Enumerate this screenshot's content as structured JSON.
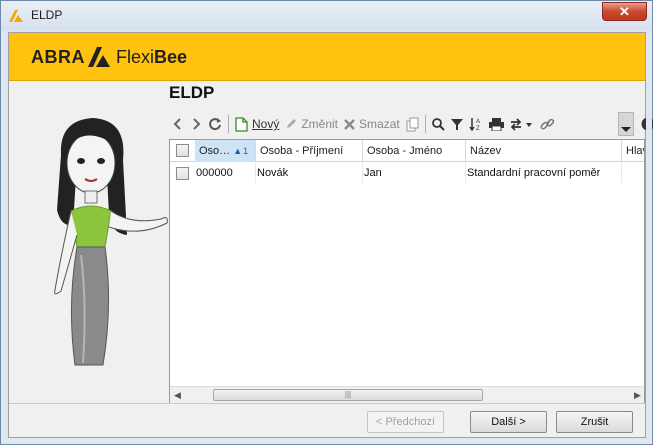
{
  "window": {
    "title": "ELDP",
    "close_label": "✕"
  },
  "brand": {
    "abra": "ABRA",
    "flexi": "Flexi",
    "bee": "Bee",
    "accent": "#ffc20e"
  },
  "page": {
    "heading": "ELDP"
  },
  "toolbar": {
    "new_label": "Nový",
    "edit_label": "Změnit",
    "delete_label": "Smazat"
  },
  "table": {
    "columns": [
      "Oso…",
      "Osoba - Příjmení",
      "Osoba - Jméno",
      "Název",
      "Hlav"
    ],
    "sort_indicator": "1",
    "rows": [
      {
        "code": "000000",
        "surname": "Novák",
        "firstname": "Jan",
        "name": "Standardní pracovní poměr"
      }
    ]
  },
  "buttons": {
    "prev": "< Předchozí",
    "next": "Další >",
    "cancel": "Zrušit"
  }
}
